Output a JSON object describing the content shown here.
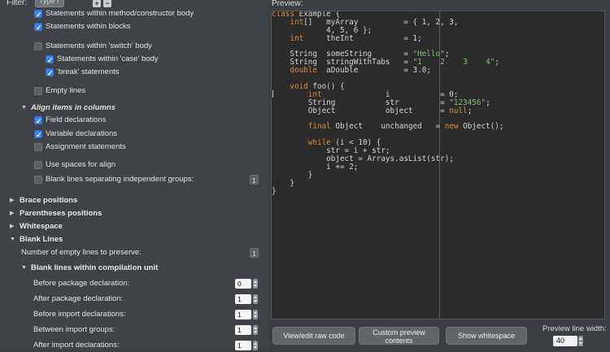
{
  "topbar": {
    "filter_label": "Filter:",
    "filter_value": "Type f",
    "add_icon": "plus-icon",
    "remove_icon": "minus-icon"
  },
  "options": {
    "statements_method_body": "Statements within method/constructor body",
    "statements_blocks": "Statements within blocks",
    "statements_switch_body": "Statements within 'switch' body",
    "statements_case_body": "Statements within 'case' body",
    "break_statements": "'break' statements",
    "empty_lines": "Empty lines",
    "align_items_section": "Align items in columns",
    "field_declarations": "Field declarations",
    "variable_declarations": "Variable declarations",
    "assignment_statements": "Assignment statements",
    "use_spaces_for_align": "Use spaces for align",
    "blank_lines_separating": "Blank lines separating independent groups:",
    "blank_lines_separating_value": "1",
    "brace_positions": "Brace positions",
    "parentheses_positions": "Parentheses positions",
    "whitespace": "Whitespace",
    "blank_lines": "Blank Lines",
    "num_empty_lines": "Number of empty lines to preserve:",
    "num_empty_lines_value": "1",
    "blank_lines_within_cu": "Blank lines within compilation unit",
    "before_package": "Before package declaration:",
    "before_package_value": "0",
    "after_package": "After package declaration:",
    "after_package_value": "1",
    "before_import": "Before import declarations:",
    "before_import_value": "1",
    "between_import_groups": "Between import groups:",
    "between_import_groups_value": "1",
    "after_import": "After import declarations:",
    "after_import_value": "1"
  },
  "preview": {
    "label": "Preview:",
    "code_lines": [
      [
        {
          "t": "class",
          "c": "kw"
        },
        {
          "t": " Example {"
        }
      ],
      [
        {
          "t": "    "
        },
        {
          "t": "int",
          "c": "kw"
        },
        {
          "t": "[]   myArray          = { 1, 2, 3,"
        }
      ],
      [
        {
          "t": "            4, 5, 6 };"
        }
      ],
      [
        {
          "t": "    "
        },
        {
          "t": "int",
          "c": "kw"
        },
        {
          "t": "     theInt           = 1;"
        }
      ],
      [
        {
          "t": ""
        }
      ],
      [
        {
          "t": "    String  someString       = "
        },
        {
          "t": "\"Hello\"",
          "c": "str"
        },
        {
          "t": ";"
        }
      ],
      [
        {
          "t": "    String  stringWithTabs   = "
        },
        {
          "t": "\"1    2    3    4\"",
          "c": "str"
        },
        {
          "t": ";"
        }
      ],
      [
        {
          "t": "    "
        },
        {
          "t": "double",
          "c": "kw"
        },
        {
          "t": "  aDouble          = 3.0;"
        }
      ],
      [
        {
          "t": ""
        }
      ],
      [
        {
          "t": "    "
        },
        {
          "t": "void",
          "c": "kw"
        },
        {
          "t": " foo() {"
        }
      ],
      [
        {
          "t": "        "
        },
        {
          "t": "int",
          "c": "kw"
        },
        {
          "t": "              i           = 0;"
        }
      ],
      [
        {
          "t": "        String           str         = "
        },
        {
          "t": "\"123456\"",
          "c": "str"
        },
        {
          "t": ";"
        }
      ],
      [
        {
          "t": "        Object           object      = "
        },
        {
          "t": "null",
          "c": "kw"
        },
        {
          "t": ";"
        }
      ],
      [
        {
          "t": ""
        }
      ],
      [
        {
          "t": "        "
        },
        {
          "t": "final",
          "c": "kw"
        },
        {
          "t": " Object    unchanged   = "
        },
        {
          "t": "new",
          "c": "kw"
        },
        {
          "t": " Object();"
        }
      ],
      [
        {
          "t": ""
        }
      ],
      [
        {
          "t": "        "
        },
        {
          "t": "while",
          "c": "kw"
        },
        {
          "t": " (i < 10) {"
        }
      ],
      [
        {
          "t": "            str = i + str;"
        }
      ],
      [
        {
          "t": "            object = Arrays.asList(str);"
        }
      ],
      [
        {
          "t": "            i += 2;"
        }
      ],
      [
        {
          "t": "        }"
        }
      ],
      [
        {
          "t": "    }"
        }
      ],
      [
        {
          "t": "}"
        }
      ]
    ]
  },
  "buttons": {
    "view_edit_raw": "View/edit raw code",
    "custom_preview_1": "Custom preview",
    "custom_preview_2": "contents",
    "show_whitespace": "Show whitespace"
  },
  "preview_line_width": {
    "label": "Preview line width:",
    "value": "40"
  },
  "colors": {
    "accent": "#3b82f6",
    "keyword": "#d98a3a",
    "string": "#7ec16a"
  }
}
